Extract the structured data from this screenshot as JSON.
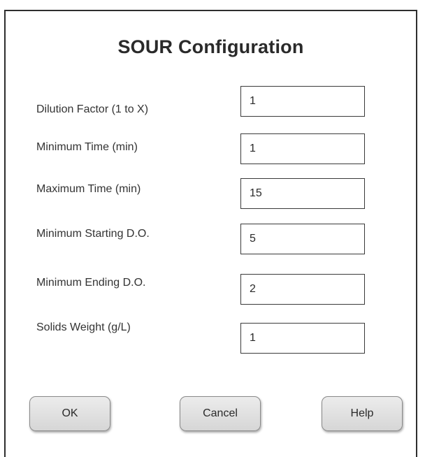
{
  "dialog": {
    "title": "SOUR Configuration",
    "fields": [
      {
        "label": "Dilution Factor (1 to X)",
        "value": "1"
      },
      {
        "label": "Minimum Time (min)",
        "value": "1"
      },
      {
        "label": "Maximum Time (min)",
        "value": "15"
      },
      {
        "label": "Minimum Starting D.O.",
        "value": "5"
      },
      {
        "label": "Minimum Ending D.O.",
        "value": "2"
      },
      {
        "label": "Solids Weight (g/L)",
        "value": "1"
      }
    ],
    "buttons": {
      "ok": "OK",
      "cancel": "Cancel",
      "help": "Help"
    }
  }
}
